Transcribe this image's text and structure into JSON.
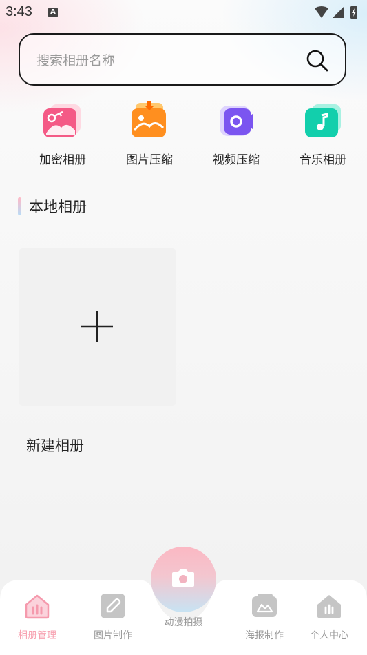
{
  "status_bar": {
    "time": "3:43",
    "notification_letter": "A"
  },
  "search": {
    "placeholder": "搜索相册名称"
  },
  "tools": [
    {
      "label": "加密相册",
      "icon": "encrypted-album-icon",
      "color": "#f4577f"
    },
    {
      "label": "图片压缩",
      "icon": "image-compress-icon",
      "color": "#ff8a1f"
    },
    {
      "label": "视频压缩",
      "icon": "video-compress-icon",
      "color": "#7a5cf0"
    },
    {
      "label": "音乐相册",
      "icon": "music-album-icon",
      "color": "#14d2b0"
    }
  ],
  "section": {
    "title": "本地相册"
  },
  "new_album": {
    "label": "新建相册"
  },
  "tabbar": {
    "tabs": [
      {
        "label": "相册管理",
        "icon": "album-manage-icon",
        "active": true
      },
      {
        "label": "图片制作",
        "icon": "image-edit-icon",
        "active": false
      },
      {
        "label": "动漫拍摄",
        "icon": "camera-icon",
        "active": false
      },
      {
        "label": "海报制作",
        "icon": "poster-icon",
        "active": false
      },
      {
        "label": "个人中心",
        "icon": "profile-icon",
        "active": false
      }
    ]
  },
  "colors": {
    "accent_pink": "#f7a2b1",
    "accent_blue": "#b8dcf7"
  }
}
